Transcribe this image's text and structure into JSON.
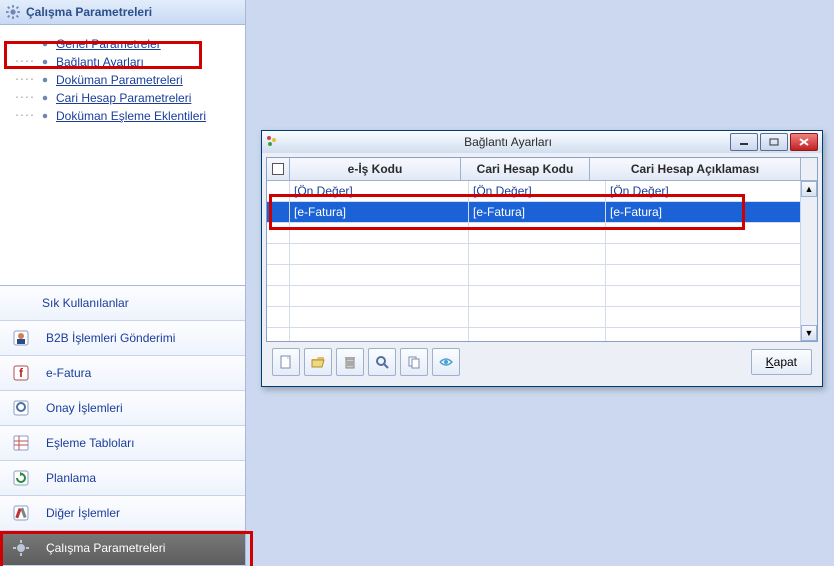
{
  "sidebar": {
    "headerTitle": "Çalışma Parametreleri",
    "tree": [
      {
        "label": "Genel Parametreler"
      },
      {
        "label": "Bağlantı Ayarları"
      },
      {
        "label": "Doküman Parametreleri"
      },
      {
        "label": "Cari Hesap Parametreleri"
      },
      {
        "label": "Doküman Eşleme Eklentileri"
      }
    ]
  },
  "nav": {
    "labels": [
      "Sık Kullanılanlar",
      "B2B İşlemleri Gönderimi",
      "e-Fatura",
      "Onay İşlemleri",
      "Eşleme Tabloları",
      "Planlama",
      "Diğer İşlemler",
      "Çalışma Parametreleri"
    ]
  },
  "window": {
    "title": "Bağlantı Ayarları",
    "columns": {
      "c1": "e-İş Kodu",
      "c2": "Cari Hesap Kodu",
      "c3": "Cari Hesap Açıklaması"
    },
    "filterHint": "[Ön Değer]",
    "rows": [
      {
        "c1": "[e-Fatura]",
        "c2": "[e-Fatura]",
        "c3": "[e-Fatura]"
      }
    ],
    "closeLabelFirst": "K",
    "closeLabelRest": "apat"
  },
  "colors": {
    "highlightRed": "#d10000",
    "selectionBlue": "#1a62d6"
  }
}
